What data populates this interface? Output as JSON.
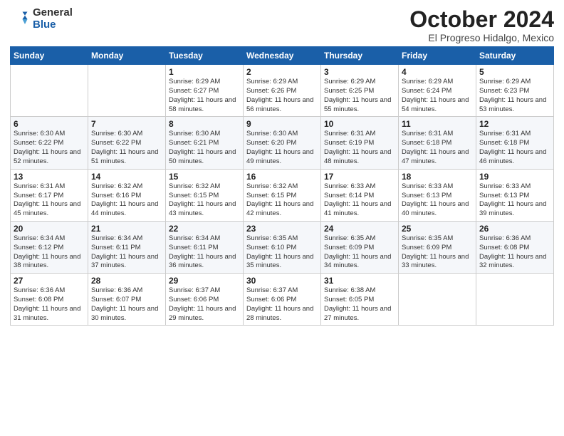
{
  "header": {
    "logo_general": "General",
    "logo_blue": "Blue",
    "month_title": "October 2024",
    "subtitle": "El Progreso Hidalgo, Mexico"
  },
  "weekdays": [
    "Sunday",
    "Monday",
    "Tuesday",
    "Wednesday",
    "Thursday",
    "Friday",
    "Saturday"
  ],
  "weeks": [
    [
      {
        "day": "",
        "info": ""
      },
      {
        "day": "",
        "info": ""
      },
      {
        "day": "1",
        "info": "Sunrise: 6:29 AM\nSunset: 6:27 PM\nDaylight: 11 hours and 58 minutes."
      },
      {
        "day": "2",
        "info": "Sunrise: 6:29 AM\nSunset: 6:26 PM\nDaylight: 11 hours and 56 minutes."
      },
      {
        "day": "3",
        "info": "Sunrise: 6:29 AM\nSunset: 6:25 PM\nDaylight: 11 hours and 55 minutes."
      },
      {
        "day": "4",
        "info": "Sunrise: 6:29 AM\nSunset: 6:24 PM\nDaylight: 11 hours and 54 minutes."
      },
      {
        "day": "5",
        "info": "Sunrise: 6:29 AM\nSunset: 6:23 PM\nDaylight: 11 hours and 53 minutes."
      }
    ],
    [
      {
        "day": "6",
        "info": "Sunrise: 6:30 AM\nSunset: 6:22 PM\nDaylight: 11 hours and 52 minutes."
      },
      {
        "day": "7",
        "info": "Sunrise: 6:30 AM\nSunset: 6:22 PM\nDaylight: 11 hours and 51 minutes."
      },
      {
        "day": "8",
        "info": "Sunrise: 6:30 AM\nSunset: 6:21 PM\nDaylight: 11 hours and 50 minutes."
      },
      {
        "day": "9",
        "info": "Sunrise: 6:30 AM\nSunset: 6:20 PM\nDaylight: 11 hours and 49 minutes."
      },
      {
        "day": "10",
        "info": "Sunrise: 6:31 AM\nSunset: 6:19 PM\nDaylight: 11 hours and 48 minutes."
      },
      {
        "day": "11",
        "info": "Sunrise: 6:31 AM\nSunset: 6:18 PM\nDaylight: 11 hours and 47 minutes."
      },
      {
        "day": "12",
        "info": "Sunrise: 6:31 AM\nSunset: 6:18 PM\nDaylight: 11 hours and 46 minutes."
      }
    ],
    [
      {
        "day": "13",
        "info": "Sunrise: 6:31 AM\nSunset: 6:17 PM\nDaylight: 11 hours and 45 minutes."
      },
      {
        "day": "14",
        "info": "Sunrise: 6:32 AM\nSunset: 6:16 PM\nDaylight: 11 hours and 44 minutes."
      },
      {
        "day": "15",
        "info": "Sunrise: 6:32 AM\nSunset: 6:15 PM\nDaylight: 11 hours and 43 minutes."
      },
      {
        "day": "16",
        "info": "Sunrise: 6:32 AM\nSunset: 6:15 PM\nDaylight: 11 hours and 42 minutes."
      },
      {
        "day": "17",
        "info": "Sunrise: 6:33 AM\nSunset: 6:14 PM\nDaylight: 11 hours and 41 minutes."
      },
      {
        "day": "18",
        "info": "Sunrise: 6:33 AM\nSunset: 6:13 PM\nDaylight: 11 hours and 40 minutes."
      },
      {
        "day": "19",
        "info": "Sunrise: 6:33 AM\nSunset: 6:13 PM\nDaylight: 11 hours and 39 minutes."
      }
    ],
    [
      {
        "day": "20",
        "info": "Sunrise: 6:34 AM\nSunset: 6:12 PM\nDaylight: 11 hours and 38 minutes."
      },
      {
        "day": "21",
        "info": "Sunrise: 6:34 AM\nSunset: 6:11 PM\nDaylight: 11 hours and 37 minutes."
      },
      {
        "day": "22",
        "info": "Sunrise: 6:34 AM\nSunset: 6:11 PM\nDaylight: 11 hours and 36 minutes."
      },
      {
        "day": "23",
        "info": "Sunrise: 6:35 AM\nSunset: 6:10 PM\nDaylight: 11 hours and 35 minutes."
      },
      {
        "day": "24",
        "info": "Sunrise: 6:35 AM\nSunset: 6:09 PM\nDaylight: 11 hours and 34 minutes."
      },
      {
        "day": "25",
        "info": "Sunrise: 6:35 AM\nSunset: 6:09 PM\nDaylight: 11 hours and 33 minutes."
      },
      {
        "day": "26",
        "info": "Sunrise: 6:36 AM\nSunset: 6:08 PM\nDaylight: 11 hours and 32 minutes."
      }
    ],
    [
      {
        "day": "27",
        "info": "Sunrise: 6:36 AM\nSunset: 6:08 PM\nDaylight: 11 hours and 31 minutes."
      },
      {
        "day": "28",
        "info": "Sunrise: 6:36 AM\nSunset: 6:07 PM\nDaylight: 11 hours and 30 minutes."
      },
      {
        "day": "29",
        "info": "Sunrise: 6:37 AM\nSunset: 6:06 PM\nDaylight: 11 hours and 29 minutes."
      },
      {
        "day": "30",
        "info": "Sunrise: 6:37 AM\nSunset: 6:06 PM\nDaylight: 11 hours and 28 minutes."
      },
      {
        "day": "31",
        "info": "Sunrise: 6:38 AM\nSunset: 6:05 PM\nDaylight: 11 hours and 27 minutes."
      },
      {
        "day": "",
        "info": ""
      },
      {
        "day": "",
        "info": ""
      }
    ]
  ]
}
